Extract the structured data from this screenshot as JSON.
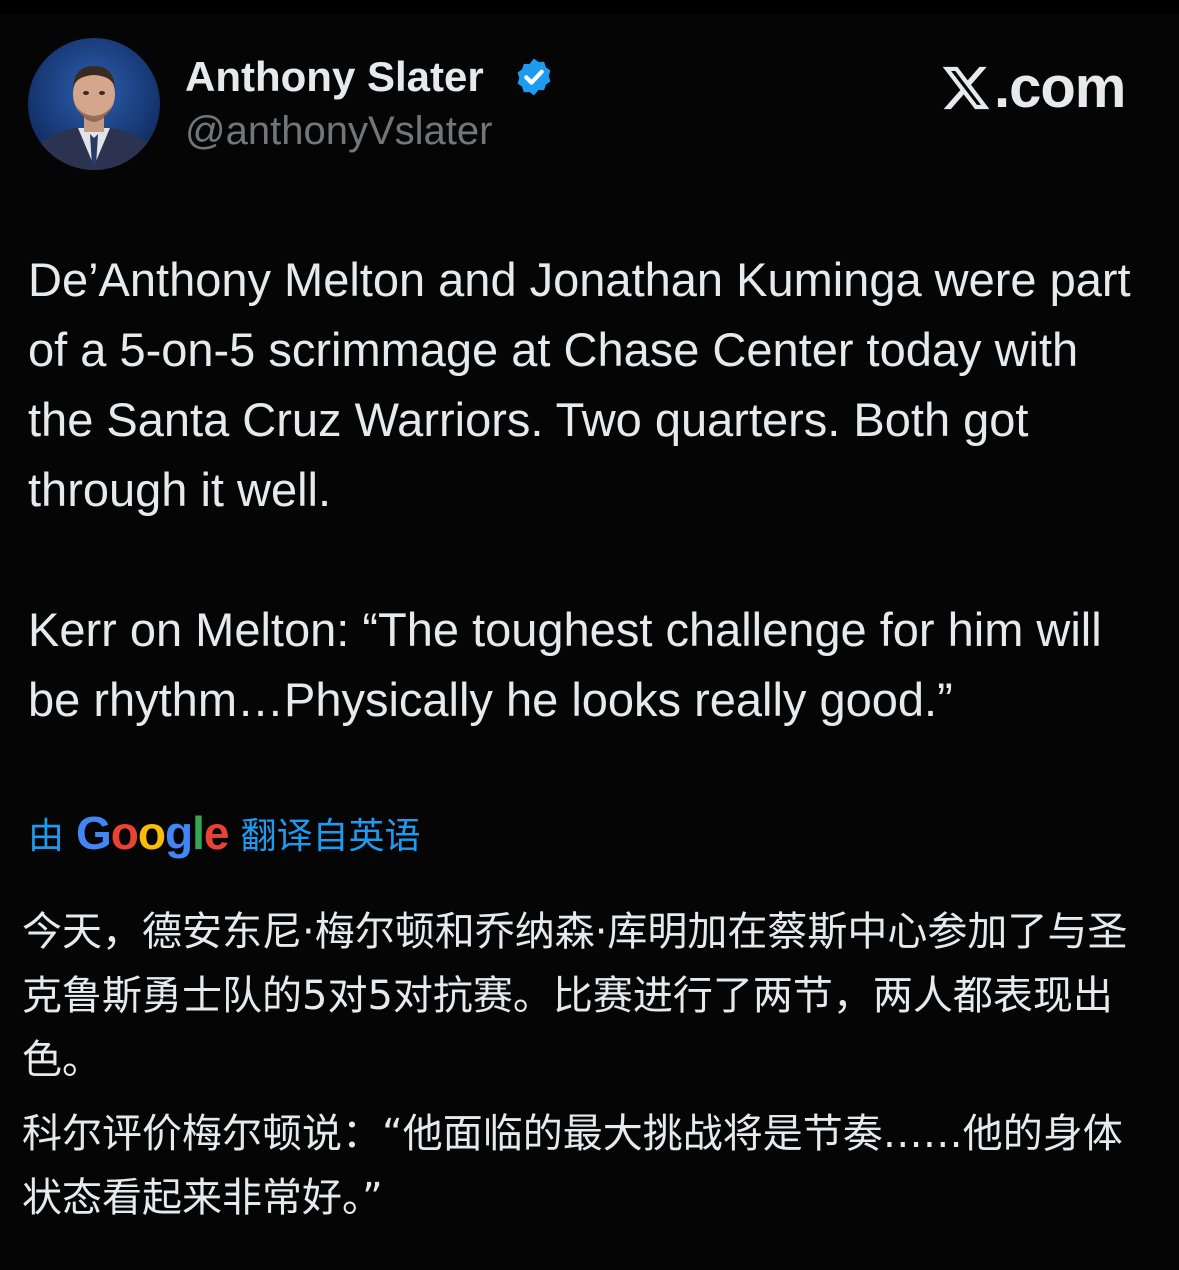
{
  "author": {
    "display_name": "Anthony Slater",
    "handle": "@anthonyVslater",
    "verified": true,
    "avatar": "profile-photo"
  },
  "brand": {
    "icon": "x-logo",
    "label": ".com"
  },
  "tweet": {
    "paragraphs": [
      "De’Anthony Melton and Jonathan Kuminga were part of a 5-on-5 scrimmage at Chase Center today with the Santa Cruz Warriors. Two quarters. Both got through it well.",
      "Kerr on Melton: “The toughest challenge for him will be rhythm…Physically he looks really good.”"
    ]
  },
  "translation": {
    "prefix": "由",
    "provider": "Google",
    "suffix": "翻译自英语",
    "paragraphs": [
      "今天，德安东尼·梅尔顿和乔纳森·库明加在蔡斯中心参加了与圣克鲁斯勇士队的5对5对抗赛。比赛进行了两节，两人都表现出色。",
      "科尔评价梅尔顿说：“他面临的最大挑战将是节奏……他的身体状态看起来非常好。”"
    ]
  },
  "colors": {
    "background": "#000000",
    "text": "#e7e9ea",
    "secondary": "#71767b",
    "link": "#1d9bf0",
    "verified": "#1d9bf0"
  }
}
